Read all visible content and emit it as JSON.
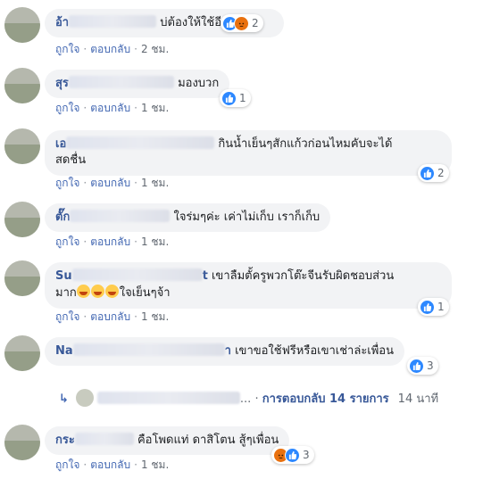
{
  "comments": [
    {
      "name": "อ้า",
      "text": "บ่ต้องให้ใช้อีก",
      "reactions": [
        "like",
        "angry"
      ],
      "count": "2",
      "like": "ถูกใจ",
      "reply": "ตอบกลับ",
      "time": "2 ชม."
    },
    {
      "name": "สุร",
      "text": "มองบวก",
      "reactions": [
        "like"
      ],
      "count": "1",
      "like": "ถูกใจ",
      "reply": "ตอบกลับ",
      "time": "1 ชม."
    },
    {
      "name": "เอ",
      "text": "กินน้ำเย็นๆสักแก้วก่อนไหมคับจะได้",
      "text2": "สดชื่น",
      "reactions": [
        "like"
      ],
      "count": "2",
      "like": "ถูกใจ",
      "reply": "ตอบกลับ",
      "time": "1 ชม."
    },
    {
      "name": "ตั๊ก",
      "text": "ใจร่มๆค่ะ เค่าไม่เก็บ เราก็เก็บ",
      "like": "ถูกใจ",
      "reply": "ตอบกลับ",
      "time": "1 ชม."
    },
    {
      "name": "Su",
      "name_tail": "t",
      "text": "เขาลืมตั้ครูพวกโต๊ะจีนรับผิดชอบส่วน",
      "text2_pre": "มาก",
      "text2": "ใจเย็นๆจ้า",
      "reactions": [
        "like"
      ],
      "count": "1",
      "like": "ถูกใจ",
      "reply": "ตอบกลับ",
      "time": "1 ชม."
    },
    {
      "name": "Na",
      "name_tail": "า",
      "text": "เขาขอใช้ฟรีหรือเขาเช่าล่ะเพื่อน",
      "reactions": [
        "like"
      ],
      "count": "3"
    },
    {
      "name": "กระ",
      "text": "คือโพดแท่ ดาสิโตน สู้ๆเพื่อน",
      "reactions": [
        "angry",
        "like"
      ],
      "count": "3",
      "like": "ถูกใจ",
      "reply": "ตอบกลับ",
      "time": "1 ชม."
    }
  ],
  "replies": {
    "dots": "...",
    "label": "การตอบกลับ 14 รายการ",
    "time": "14 นาที"
  },
  "colors": {
    "link": "#385898",
    "like": "#2d88ff",
    "angry": "#e9710f",
    "bubble": "#f2f3f5"
  }
}
